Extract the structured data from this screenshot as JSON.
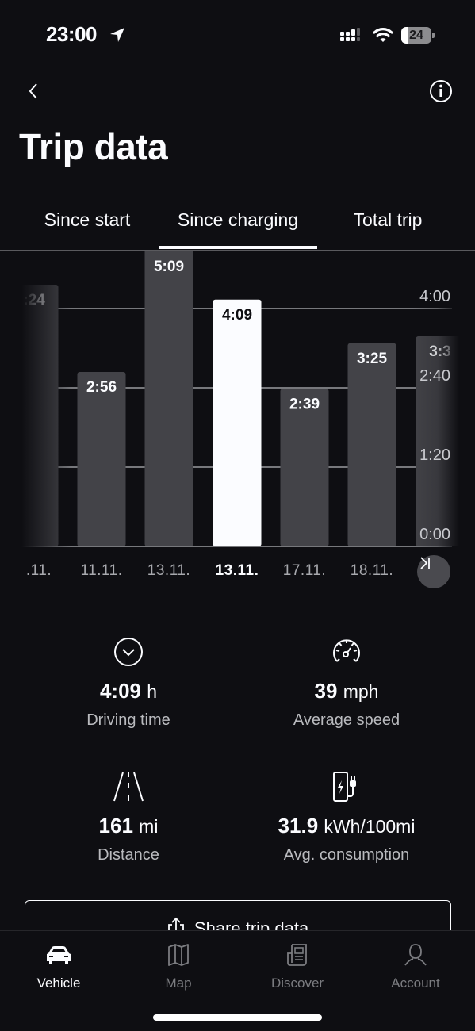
{
  "status_bar": {
    "time": "23:00",
    "location_icon": "location-arrow-icon",
    "signal_icon": "cellular-signal-icon",
    "wifi_icon": "wifi-icon",
    "battery_level": 24,
    "battery_text": "24"
  },
  "header": {
    "back_icon": "chevron-left-icon",
    "info_icon": "info-icon",
    "title": "Trip data"
  },
  "tabs": [
    {
      "label": "Since start",
      "active": false
    },
    {
      "label": "Since charging",
      "active": true
    },
    {
      "label": "Total trip",
      "active": false
    }
  ],
  "chart_data": {
    "type": "bar",
    "title": "",
    "xlabel": "",
    "ylabel": "Driving time",
    "ylim_minutes": [
      0,
      240
    ],
    "yticks": [
      "0:00",
      "1:20",
      "2:40",
      "4:00"
    ],
    "grid": true,
    "categories": [
      ".11.",
      "11.11.",
      "13.11.",
      "13.11.",
      "17.11.",
      "18.11.",
      ""
    ],
    "value_labels": [
      ":24",
      "2:56",
      "5:09",
      "4:09",
      "2:39",
      "3:25",
      "3:3"
    ],
    "values_minutes": [
      264,
      176,
      309,
      249,
      159,
      205,
      212
    ],
    "selected_index": 3,
    "colors": {
      "bar": "#434348",
      "selected_bar": "#fbfcff",
      "grid": "#9a9ba0"
    }
  },
  "chart_controls": {
    "next_icon": "skip-to-end-icon"
  },
  "stats": [
    {
      "icon": "clock-icon",
      "value": "4:09",
      "unit": "h",
      "label": "Driving time"
    },
    {
      "icon": "speedometer-icon",
      "value": "39",
      "unit": "mph",
      "label": "Average speed"
    },
    {
      "icon": "road-icon",
      "value": "161",
      "unit": "mi",
      "label": "Distance"
    },
    {
      "icon": "charging-station-icon",
      "value": "31.9",
      "unit": "kWh/100mi",
      "label": "Avg. consumption"
    }
  ],
  "share_button": {
    "icon": "share-icon",
    "label": "Share trip data"
  },
  "nav": [
    {
      "icon": "car-icon",
      "label": "Vehicle",
      "active": true
    },
    {
      "icon": "map-icon",
      "label": "Map",
      "active": false
    },
    {
      "icon": "newspaper-icon",
      "label": "Discover",
      "active": false
    },
    {
      "icon": "person-icon",
      "label": "Account",
      "active": false
    }
  ]
}
